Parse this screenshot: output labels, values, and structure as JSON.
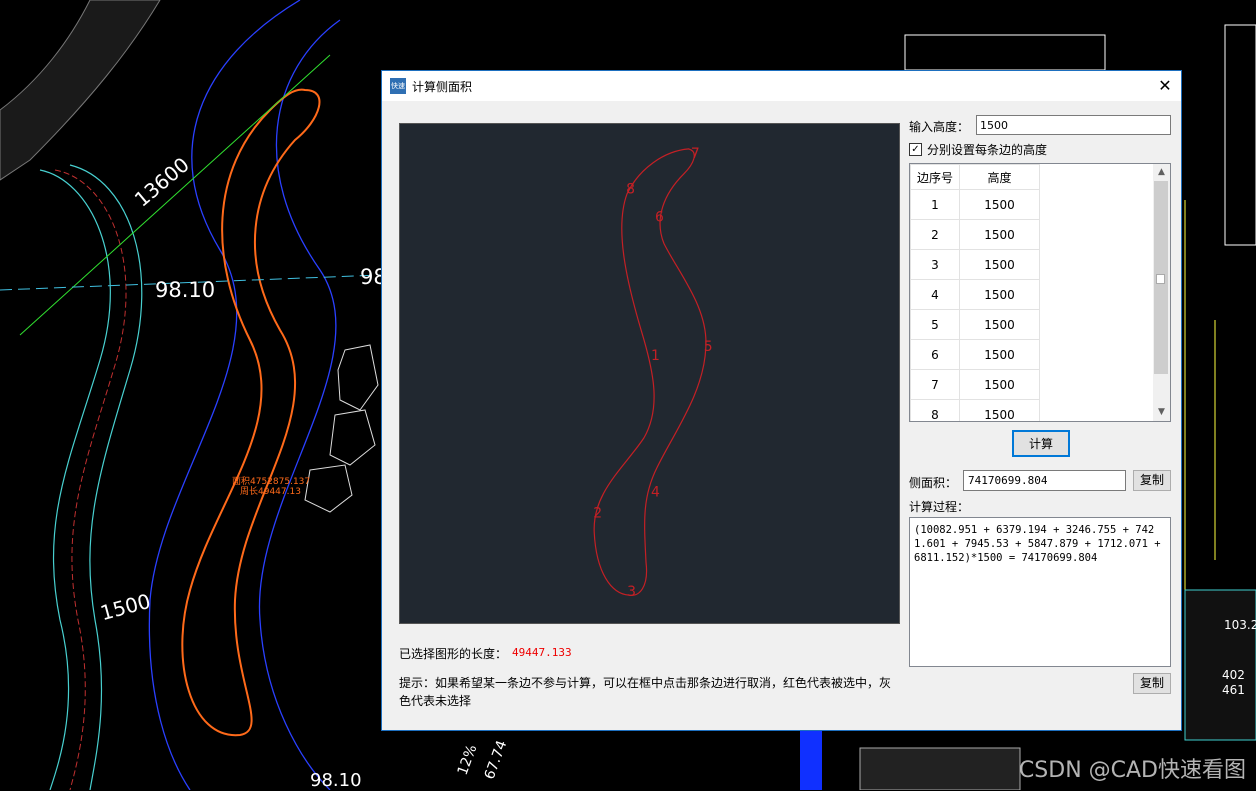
{
  "cad": {
    "labels": [
      "13600",
      "98.10",
      "98",
      "1500",
      "98.10",
      "12%",
      "67.74",
      "103.2",
      "402",
      "461"
    ],
    "tag_lines": [
      "面积4752875.137",
      "周长49447.13"
    ]
  },
  "watermark": "CSDN @CAD快速看图",
  "dialog": {
    "icon_text": "快速",
    "title": "计算侧面积",
    "close_symbol": "✕"
  },
  "preview": {
    "edge_labels": [
      "1",
      "2",
      "3",
      "4",
      "5",
      "6",
      "7",
      "8"
    ],
    "stroke_color": "#c42025"
  },
  "length": {
    "label": "已选择图形的长度：",
    "value": "49447.133"
  },
  "hint": "提示：如果希望某一条边不参与计算，可以在框中点击那条边进行取消，红色代表被选中，灰色代表未选择",
  "height": {
    "label": "输入高度：",
    "value": "1500"
  },
  "per_edge": {
    "checked": true,
    "check_mark": "✓",
    "label": "分别设置每条边的高度"
  },
  "table": {
    "headers": [
      "边序号",
      "高度"
    ],
    "rows": [
      [
        "1",
        "1500"
      ],
      [
        "2",
        "1500"
      ],
      [
        "3",
        "1500"
      ],
      [
        "4",
        "1500"
      ],
      [
        "5",
        "1500"
      ],
      [
        "6",
        "1500"
      ],
      [
        "7",
        "1500"
      ],
      [
        "8",
        "1500"
      ]
    ]
  },
  "calc_button": "计算",
  "area": {
    "label": "侧面积：",
    "value": "74170699.804",
    "copy": "复制"
  },
  "process": {
    "label": "计算过程：",
    "text": "(10082.951 + 6379.194 + 3246.755 + 7421.601 + 7945.53 + 5847.879 + 1712.071 + 6811.152)*1500 = 74170699.804",
    "copy": "复制"
  }
}
